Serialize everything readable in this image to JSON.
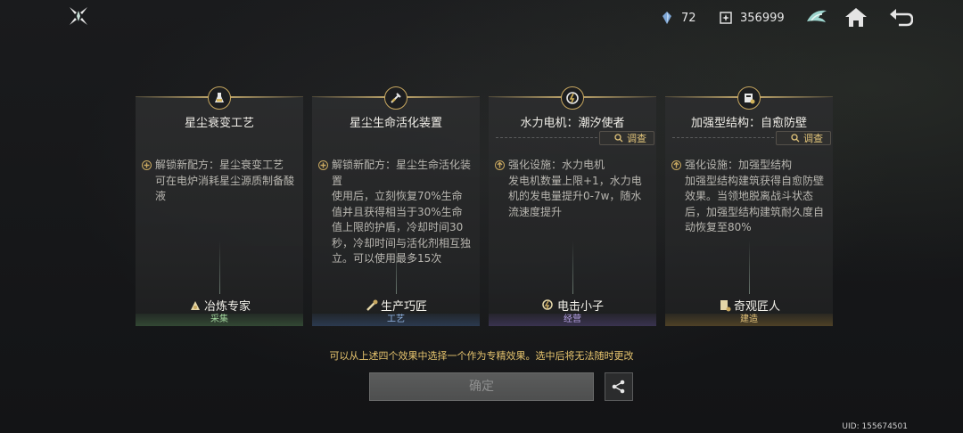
{
  "header": {
    "logo_icon": "star-compass-icon",
    "breadcrumb": "",
    "resources": [
      {
        "icon": "crystal-icon",
        "value": "72"
      },
      {
        "icon": "stardust-icon",
        "value": "356999"
      }
    ],
    "buttons": [
      "bird-emblem-icon",
      "home-icon",
      "back-icon"
    ]
  },
  "cards": [
    {
      "badge_icon": "flask-icon",
      "title": "星尘衰变工艺",
      "investigate": "",
      "desc": "解锁新配方：星尘衰变工艺\n可在电炉消耗星尘源质制备酸液",
      "role_icon": "smelter-icon",
      "role": "冶炼专家",
      "category": "采集"
    },
    {
      "badge_icon": "syringe-icon",
      "title": "星尘生命活化装置",
      "investigate": "",
      "desc": "解锁新配方：星尘生命活化装置\n使用后，立刻恢复70%生命值并且获得相当于30%生命值上限的护盾，冷却时间30秒，冷却时间与活化剂相互独立。可以使用最多15次",
      "role_icon": "craftsman-icon",
      "role": "生产巧匠",
      "category": "工艺"
    },
    {
      "badge_icon": "generator-icon",
      "title": "水力电机：潮汐使者",
      "investigate": "调查",
      "desc": "强化设施：水力电机\n发电机数量上限+1，水力电机的发电量提升0-7w，随水流速度提升",
      "role_icon": "electric-icon",
      "role": "电击小子",
      "category": "经营"
    },
    {
      "badge_icon": "structure-icon",
      "title": "加强型结构：自愈防壁",
      "investigate": "调查",
      "desc": "强化设施：加强型结构\n加强型结构建筑获得自愈防壁效果。当领地脱离战斗状态后，加强型结构建筑耐久度自动恢复至80%",
      "role_icon": "builder-icon",
      "role": "奇观匠人",
      "category": "建造"
    }
  ],
  "hint": "可以从上述四个效果中选择一个作为专精效果。选中后将无法随时更改",
  "confirm_label": "确定",
  "share_icon": "share-icon",
  "uid": "UID: 155674501"
}
